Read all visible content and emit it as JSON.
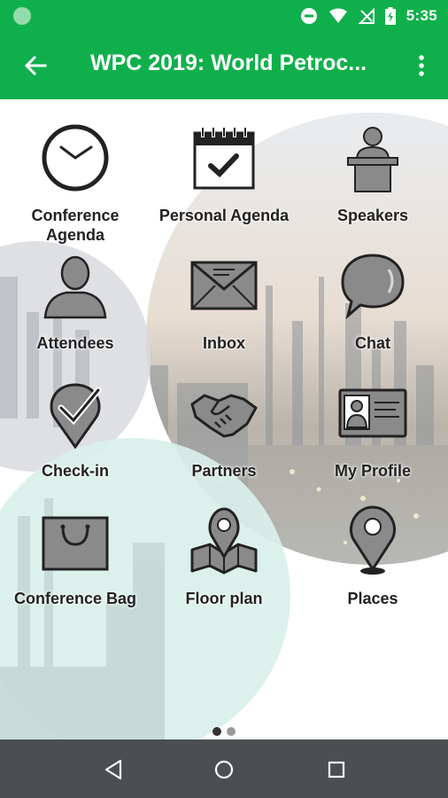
{
  "status": {
    "time": "5:35"
  },
  "appbar": {
    "title": "WPC 2019: World Petroc..."
  },
  "tiles": [
    {
      "label": "Conference Agenda",
      "icon": "clock-icon"
    },
    {
      "label": "Personal Agenda",
      "icon": "calendar-check-icon"
    },
    {
      "label": "Speakers",
      "icon": "speaker-podium-icon"
    },
    {
      "label": "Attendees",
      "icon": "person-icon"
    },
    {
      "label": "Inbox",
      "icon": "envelope-icon"
    },
    {
      "label": "Chat",
      "icon": "chat-bubble-icon"
    },
    {
      "label": "Check-in",
      "icon": "checkin-pin-icon"
    },
    {
      "label": "Partners",
      "icon": "handshake-icon"
    },
    {
      "label": "My Profile",
      "icon": "id-card-icon"
    },
    {
      "label": "Conference Bag",
      "icon": "bag-icon"
    },
    {
      "label": "Floor plan",
      "icon": "map-icon"
    },
    {
      "label": "Places",
      "icon": "location-pin-icon"
    }
  ],
  "pager": {
    "pages": 2,
    "current": 1
  },
  "colors": {
    "accent": "#0fb04b",
    "icon_gray": "#8a8a8a",
    "icon_dark": "#222222",
    "navbar": "#4b4f52"
  }
}
